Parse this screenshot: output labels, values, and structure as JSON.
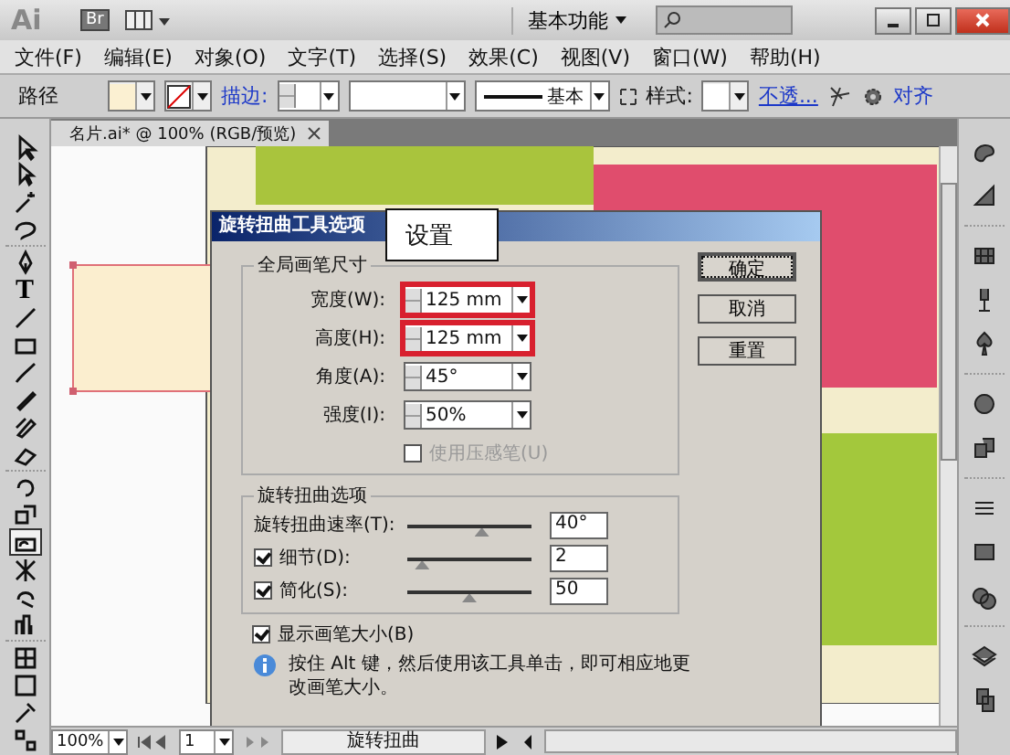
{
  "app_bar": {
    "logo": "Ai",
    "bridge": "Br",
    "workspace": "基本功能"
  },
  "menu": [
    "文件(F)",
    "编辑(E)",
    "对象(O)",
    "文字(T)",
    "选择(S)",
    "效果(C)",
    "视图(V)",
    "窗口(W)",
    "帮助(H)"
  ],
  "control_bar": {
    "label": "路径",
    "stroke_label": "描边:",
    "stroke_profile": "基本",
    "style_label": "样式:",
    "opacity_link": "不透...",
    "align_link": "对齐"
  },
  "document_tab": {
    "title": "名片.ai* @ 100% (RGB/预览)"
  },
  "tools": [
    {
      "selected": false
    },
    {
      "selected": false
    },
    {
      "selected": false
    },
    {
      "selected": false
    },
    {
      "selected": false
    },
    {
      "selected": false,
      "label": "T"
    },
    {
      "selected": false
    },
    {
      "selected": false
    },
    {
      "selected": false
    },
    {
      "selected": false
    },
    {
      "selected": false
    },
    {
      "selected": false
    },
    {
      "selected": false
    },
    {
      "selected": false
    },
    {
      "selected": true
    },
    {
      "selected": false
    },
    {
      "selected": false
    },
    {
      "selected": false
    },
    {
      "selected": false
    },
    {
      "selected": false
    },
    {
      "selected": false
    },
    {
      "selected": false
    }
  ],
  "dialog": {
    "title": "旋转扭曲工具选项",
    "callout": "设置",
    "brush_group": {
      "title": "全局画笔尺寸",
      "fields": [
        {
          "label": "宽度(W):",
          "value": "125 mm",
          "highlighted": true
        },
        {
          "label": "高度(H):",
          "value": "125 mm",
          "highlighted": true
        },
        {
          "label": "角度(A):",
          "value": "45°",
          "highlighted": false
        },
        {
          "label": "强度(I):",
          "value": "50%",
          "highlighted": false
        }
      ],
      "pressure": {
        "label": "使用压感笔(U)",
        "checked": false,
        "disabled": true
      }
    },
    "twirl_group": {
      "title": "旋转扭曲选项",
      "sliders": [
        {
          "kind": "plain",
          "label": "旋转扭曲速率(T):",
          "level": 0.6,
          "value": "40°"
        },
        {
          "kind": "checkbox",
          "label": "细节(D):",
          "checked": true,
          "level": 0.12,
          "value": "2"
        },
        {
          "kind": "checkbox",
          "label": "简化(S):",
          "checked": true,
          "level": 0.5,
          "value": "50"
        }
      ]
    },
    "show_brush_size": {
      "label": "显示画笔大小(B)",
      "checked": true
    },
    "info": "按住 Alt 键，然后使用该工具单击，即可相应地更改画笔大小。",
    "buttons": [
      {
        "label": "确定",
        "default": true
      },
      {
        "label": "取消",
        "default": false
      },
      {
        "label": "重置",
        "default": false
      }
    ]
  },
  "status_bar": {
    "zoom": "100%",
    "page": "1",
    "tool": "旋转扭曲"
  }
}
